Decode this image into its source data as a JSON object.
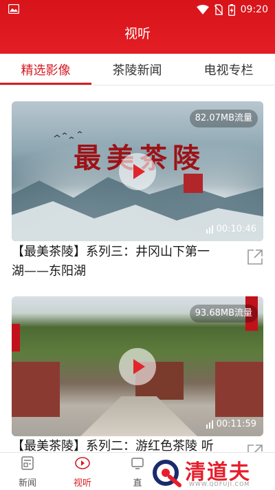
{
  "status_bar": {
    "time": "09:20"
  },
  "header": {
    "title": "视听"
  },
  "tabs": [
    {
      "label": "精选影像",
      "active": true
    },
    {
      "label": "茶陵新闻",
      "active": false
    },
    {
      "label": "电视专栏",
      "active": false
    }
  ],
  "videos": [
    {
      "title": "【最美茶陵】系列三：井冈山下第一湖——东阳湖",
      "title_line1": "【最美茶陵】系列三：井冈山下第一",
      "title_line2": "湖——东阳湖",
      "traffic": "82.07MB流量",
      "duration": "00:10:46",
      "overlay_text": "最美茶陵"
    },
    {
      "title_line1": "【最美茶陵】系列二：游红色茶陵 听",
      "traffic": "93.68MB流量",
      "duration": "00:11:59"
    }
  ],
  "bottom_nav": [
    {
      "label": "新闻",
      "icon": "news-icon",
      "active": false
    },
    {
      "label": "视听",
      "icon": "audiovisual-icon",
      "active": true
    },
    {
      "label": "直",
      "icon": "live-icon",
      "active": false
    }
  ],
  "watermark": {
    "text": "清道夫",
    "url": "WWW.QDFUJI.COM"
  },
  "colors": {
    "accent": "#d51c23",
    "header_bg": "#e31e24"
  }
}
